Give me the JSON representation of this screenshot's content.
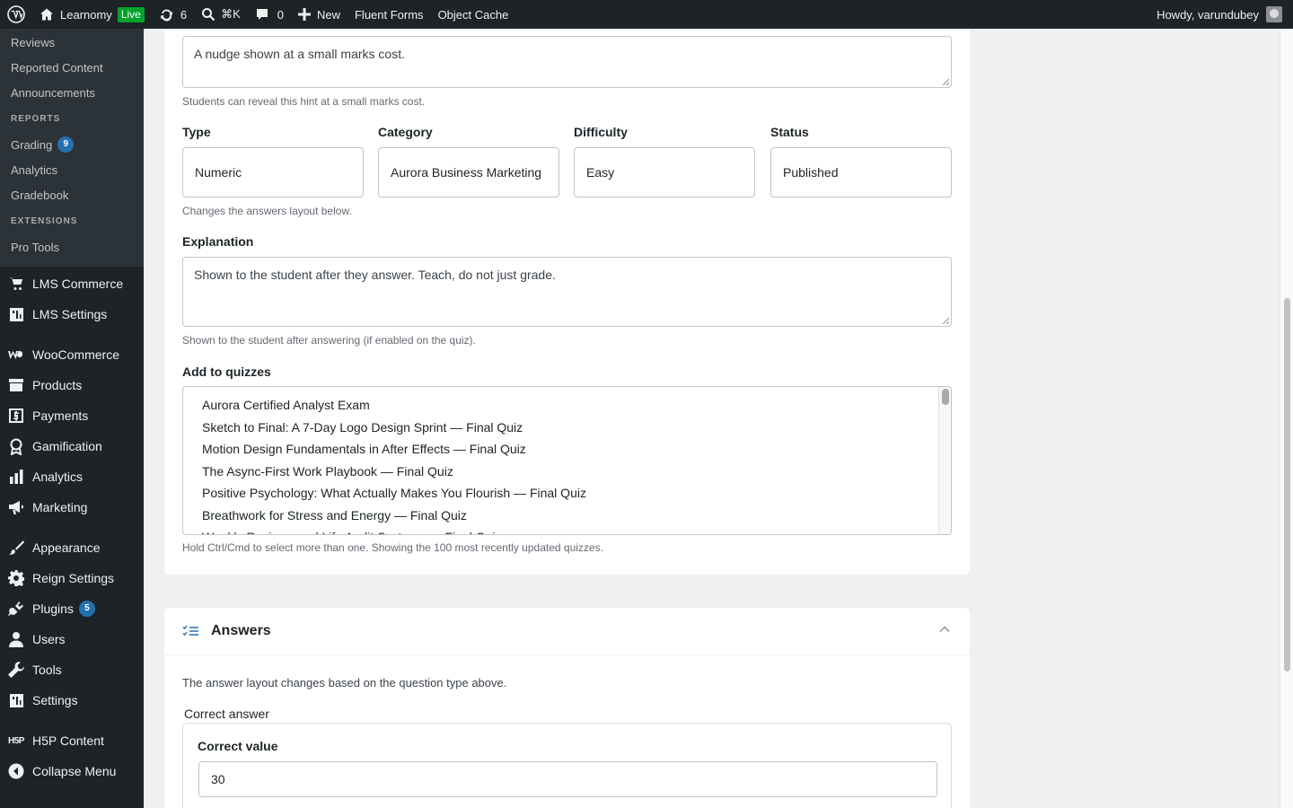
{
  "adminbar": {
    "site_name": "Learnomy",
    "live_badge": "Live",
    "updates_count": "6",
    "search_shortcut": "⌘K",
    "comments_count": "0",
    "new_label": "New",
    "fluent_forms": "Fluent Forms",
    "object_cache": "Object Cache",
    "howdy": "Howdy, varundubey"
  },
  "sidebar": {
    "sub_items_top": [
      {
        "label": "Reviews"
      },
      {
        "label": "Reported Content"
      },
      {
        "label": "Announcements"
      }
    ],
    "reports_heading": "REPORTS",
    "reports_items": [
      {
        "label": "Grading",
        "badge": "9"
      },
      {
        "label": "Analytics"
      },
      {
        "label": "Gradebook"
      }
    ],
    "extensions_heading": "EXTENSIONS",
    "extensions_items": [
      {
        "label": "Pro Tools"
      }
    ],
    "menu": [
      {
        "label": "LMS Commerce",
        "icon": "cart-icon"
      },
      {
        "label": "LMS Settings",
        "icon": "settings-grid-icon"
      },
      {
        "label": "WooCommerce",
        "icon": "woocommerce-icon"
      },
      {
        "label": "Products",
        "icon": "products-icon"
      },
      {
        "label": "Payments",
        "icon": "payments-icon"
      },
      {
        "label": "Gamification",
        "icon": "award-icon"
      },
      {
        "label": "Analytics",
        "icon": "bar-chart-icon"
      },
      {
        "label": "Marketing",
        "icon": "megaphone-icon"
      },
      {
        "label": "Appearance",
        "icon": "brush-icon"
      },
      {
        "label": "Reign Settings",
        "icon": "gear-icon"
      },
      {
        "label": "Plugins",
        "icon": "plugin-icon",
        "badge": "5"
      },
      {
        "label": "Users",
        "icon": "user-icon"
      },
      {
        "label": "Tools",
        "icon": "wrench-icon"
      },
      {
        "label": "Settings",
        "icon": "settings-grid-icon"
      },
      {
        "label": "H5P Content",
        "icon": "h5p-icon"
      },
      {
        "label": "Collapse Menu",
        "icon": "collapse-icon"
      }
    ]
  },
  "hint": {
    "value": "A nudge shown at a small marks cost.",
    "help": "Students can reveal this hint at a small marks cost."
  },
  "fields": {
    "type_label": "Type",
    "type_value": "Numeric",
    "category_label": "Category",
    "category_value": "Aurora Business Marketing",
    "difficulty_label": "Difficulty",
    "difficulty_value": "Easy",
    "status_label": "Status",
    "status_value": "Published",
    "type_help": "Changes the answers layout below."
  },
  "explanation": {
    "label": "Explanation",
    "placeholder": "Shown to the student after they answer. Teach, do not just grade.",
    "help": "Shown to the student after answering (if enabled on the quiz)."
  },
  "quizzes": {
    "label": "Add to quizzes",
    "options": [
      "Aurora Certified Analyst Exam",
      "Sketch to Final: A 7-Day Logo Design Sprint — Final Quiz",
      "Motion Design Fundamentals in After Effects — Final Quiz",
      "The Async-First Work Playbook — Final Quiz",
      "Positive Psychology: What Actually Makes You Flourish — Final Quiz",
      "Breathwork for Stress and Energy — Final Quiz",
      "Weekly Reviews and Life Audit Systems — Final Quiz"
    ],
    "help": "Hold Ctrl/Cmd to select more than one. Showing the 100 most recently updated quizzes."
  },
  "answers": {
    "title": "Answers",
    "intro": "The answer layout changes based on the question type above.",
    "correct_answer_label": "Correct answer",
    "correct_value_label": "Correct value",
    "correct_value": "30"
  },
  "colors": {
    "admin_bg": "#1d2327",
    "submenu_bg": "#2c3338",
    "accent": "#2271b1",
    "live": "#00a32a"
  }
}
